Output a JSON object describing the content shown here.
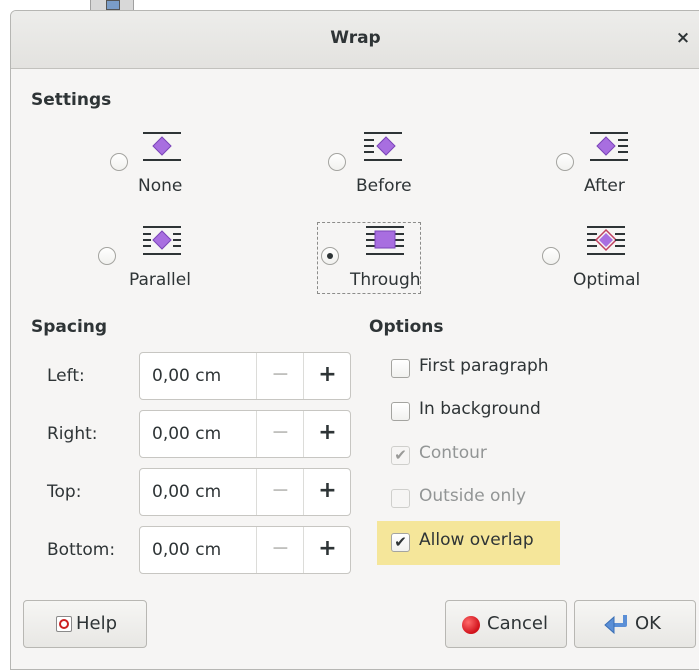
{
  "dialog": {
    "title": "Wrap",
    "close_label": "×"
  },
  "settings": {
    "title": "Settings",
    "options": [
      {
        "label": "None",
        "checked": false
      },
      {
        "label": "Before",
        "checked": false
      },
      {
        "label": "After",
        "checked": false
      },
      {
        "label": "Parallel",
        "checked": false
      },
      {
        "label": "Through",
        "checked": true
      },
      {
        "label": "Optimal",
        "checked": false
      }
    ]
  },
  "spacing": {
    "title": "Spacing",
    "fields": [
      {
        "label": "Left:",
        "value": "0,00 cm"
      },
      {
        "label": "Right:",
        "value": "0,00 cm"
      },
      {
        "label": "Top:",
        "value": "0,00 cm"
      },
      {
        "label": "Bottom:",
        "value": "0,00 cm"
      }
    ],
    "minus": "−",
    "plus": "+"
  },
  "options": {
    "title": "Options",
    "items": [
      {
        "label": "First paragraph",
        "checked": false,
        "enabled": true
      },
      {
        "label": "In background",
        "checked": false,
        "enabled": true
      },
      {
        "label": "Contour",
        "checked": true,
        "enabled": false
      },
      {
        "label": "Outside only",
        "checked": false,
        "enabled": false
      },
      {
        "label": "Allow overlap",
        "checked": true,
        "enabled": true
      }
    ],
    "check_mark": "✔"
  },
  "buttons": {
    "help": "Help",
    "cancel": "Cancel",
    "ok": "OK"
  },
  "colors": {
    "accent_purple": "#a86ee0",
    "highlight": "#f5e69a",
    "cancel_red": "#d0111a"
  }
}
